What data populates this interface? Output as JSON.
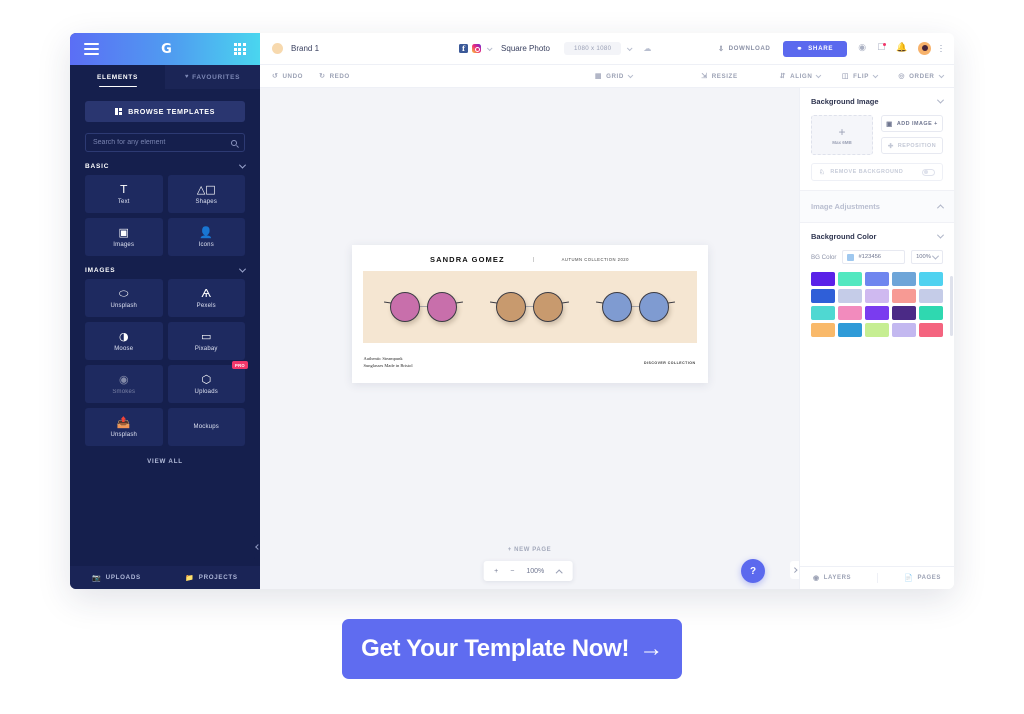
{
  "sidebar": {
    "topbar": {
      "menu_icon": "hamburger-icon",
      "logo": "G",
      "apps_icon": "grid-apps-icon"
    },
    "tabs": [
      {
        "label": "ELEMENTS",
        "active": true
      },
      {
        "label": "FAVOURITES",
        "active": false
      }
    ],
    "browse_templates_label": "BROWSE TEMPLATES",
    "search": {
      "placeholder": "Search for any element",
      "value": ""
    },
    "sections": [
      {
        "title": "BASIC",
        "tiles": [
          {
            "label": "Text",
            "icon": "T",
            "pro": false,
            "dim": false
          },
          {
            "label": "Shapes",
            "icon": "△",
            "pro": false,
            "dim": false
          },
          {
            "label": "Images",
            "icon": "Ὓc",
            "pro": false,
            "dim": false
          },
          {
            "label": "Icons",
            "icon": "὆4",
            "pro": false,
            "dim": false
          }
        ]
      },
      {
        "title": "IMAGES",
        "tiles": [
          {
            "label": "Unsplash",
            "icon": "⬭",
            "pro": false,
            "dim": false
          },
          {
            "label": "Pexels",
            "icon": "Y",
            "pro": false,
            "dim": false
          },
          {
            "label": "Moose",
            "icon": "◑",
            "pro": false,
            "dim": false
          },
          {
            "label": "Pixabay",
            "icon": "▭",
            "pro": false,
            "dim": false
          },
          {
            "label": "Smokes",
            "icon": "☉",
            "pro": false,
            "dim": true
          },
          {
            "label": "Uploads",
            "icon": "⬡",
            "pro": true,
            "dim": false
          },
          {
            "label": "Unsplash",
            "icon": "⬆",
            "pro": false,
            "dim": false
          },
          {
            "label": "Mockups",
            "icon": "",
            "pro": false,
            "dim": false
          }
        ]
      }
    ],
    "view_all_label": "VIEW ALL",
    "bottom": [
      {
        "label": "UPLOADS",
        "icon": "camera-icon"
      },
      {
        "label": "PROJECTS",
        "icon": "folder-icon"
      }
    ]
  },
  "topbar": {
    "brand_name": "Brand 1",
    "social": [
      "facebook-icon",
      "instagram-icon"
    ],
    "canvas_type": "Square Photo",
    "canvas_size": "1080 x 1080",
    "cloud_icon": "cloud-icon",
    "download_label": "DOWNLOAD",
    "share_label": "SHARE",
    "icons": [
      "eye-icon",
      "present-icon",
      "bell-icon"
    ],
    "avatar": "user-avatar",
    "kebab": "more-options-icon"
  },
  "toolbar2": {
    "undo_label": "UNDO",
    "redo_label": "REDO",
    "grid_label": "GRID",
    "resize_label": "RESIZE",
    "align_label": "ALIGN",
    "flip_label": "FLIP",
    "order_label": "ORDER"
  },
  "canvas": {
    "design": {
      "title": "SANDRA GOMEZ",
      "subtitle": "AUTUMN COLLECTION 2020",
      "tagline_line1": "Authentic Steampunk",
      "tagline_line2": "Sunglasses Made in Bristol",
      "discover_label": "DISCOVER COLLECTION",
      "band_color": "#f5e6d2",
      "glasses": [
        {
          "lens_color": "#c86fab",
          "name": "pink-sunglasses"
        },
        {
          "lens_color": "#c89a6e",
          "name": "tan-sunglasses"
        },
        {
          "lens_color": "#7f9bd1",
          "name": "blue-sunglasses"
        }
      ]
    },
    "new_page_label": "NEW PAGE",
    "zoom": {
      "plus": "+",
      "minus": "−",
      "level": "100%"
    },
    "help_label": "?"
  },
  "right_panel": {
    "background_image": {
      "title": "Background Image",
      "drop_plus": "+",
      "drop_maxsize": "Max 6MB",
      "add_image_label": "ADD IMAGE +",
      "reposition_label": "REPOSITION",
      "remove_background_label": "REMOVE BACKGROUND"
    },
    "image_adjustments": {
      "title": "Image Adjustments"
    },
    "background_color": {
      "title": "Background Color",
      "bg_color_label": "BG Color",
      "hex_value": "#123456",
      "swatch_color": "#9fc8ef",
      "opacity_value": "100%",
      "swatches": [
        "#5a21e8",
        "#52e8c0",
        "#6f86ef",
        "#6ea5d8",
        "#4fd2f0",
        "#2f5fd8",
        "#c5cce8",
        "#cfb9f0",
        "#f79a94",
        "#c5cce8",
        "#4fd8d2",
        "#f28bbd",
        "#7a3cef",
        "#4b2a86",
        "#2fd8b0",
        "#f9b96a",
        "#2f9bd8",
        "#c6ee92",
        "#c3b8f0",
        "#f4647f"
      ]
    },
    "bottom": [
      {
        "label": "LAYERS",
        "icon": "layers-icon"
      },
      {
        "label": "PAGES",
        "icon": "pages-icon"
      }
    ]
  },
  "cta": {
    "label": "Get Your Template Now!",
    "arrow": "→",
    "color": "#5f6cf0"
  }
}
